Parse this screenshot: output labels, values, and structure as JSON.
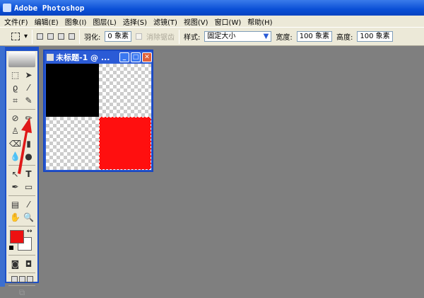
{
  "app": {
    "title": "Adobe Photoshop"
  },
  "menu": [
    "文件(F)",
    "编辑(E)",
    "图象(I)",
    "图层(L)",
    "选择(S)",
    "滤镜(T)",
    "视图(V)",
    "窗口(W)",
    "帮助(H)"
  ],
  "options": {
    "feather_label": "羽化:",
    "feather_value": "0 象素",
    "antialias_label": "消除锯齿",
    "style_label": "样式:",
    "style_value": "固定大小",
    "width_label": "宽度:",
    "width_value": "100 象素",
    "height_label": "高度:",
    "height_value": "100 象素"
  },
  "document": {
    "title": "未标题-1 @ ...",
    "squares": {
      "top_left": "#000000",
      "bottom_right": "#ff0f0f"
    }
  },
  "colors": {
    "foreground": "#ee1111",
    "background": "#ffffff",
    "annotation_arrow": "#e01818"
  },
  "tools": [
    "marquee",
    "move",
    "lasso",
    "magic-wand",
    "crop",
    "slice",
    "healing-brush",
    "pencil",
    "stamp",
    "history-brush",
    "eraser",
    "fill",
    "blur",
    "dodge",
    "path-select",
    "type",
    "pen",
    "shape",
    "notes",
    "eyedropper",
    "hand",
    "zoom"
  ]
}
